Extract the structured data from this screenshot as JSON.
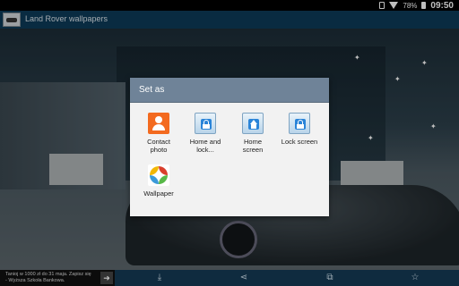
{
  "status_bar": {
    "battery": "78%",
    "time": "09:50"
  },
  "app": {
    "title": "Land Rover wallpapers"
  },
  "dialog": {
    "title": "Set as",
    "options": [
      {
        "label_lines": [
          "Contact",
          "photo"
        ],
        "icon": "contact-icon"
      },
      {
        "label_lines": [
          "Home and",
          "lock..."
        ],
        "icon": "home-and-lock-icon"
      },
      {
        "label_lines": [
          "Home",
          "screen"
        ],
        "icon": "home-screen-icon"
      },
      {
        "label_lines": [
          "Lock screen",
          ""
        ],
        "icon": "lock-screen-icon"
      },
      {
        "label_lines": [
          "Wallpaper",
          ""
        ],
        "icon": "wallpaper-icon"
      }
    ]
  },
  "ad": {
    "text_line1": "Tanioj w 1000 zł do 31 maja. Zapisz się",
    "text_line2": "- Wyższa Szkoła Bankowa."
  },
  "toolbar": {
    "icons": [
      "download-icon",
      "share-icon",
      "crop-icon",
      "favorite-icon"
    ]
  },
  "colors": {
    "appbar": "#0d3a57",
    "dialog_header": "#6f8398",
    "contact_orange": "#f36a1f",
    "badge_blue": "#2a84d8"
  }
}
